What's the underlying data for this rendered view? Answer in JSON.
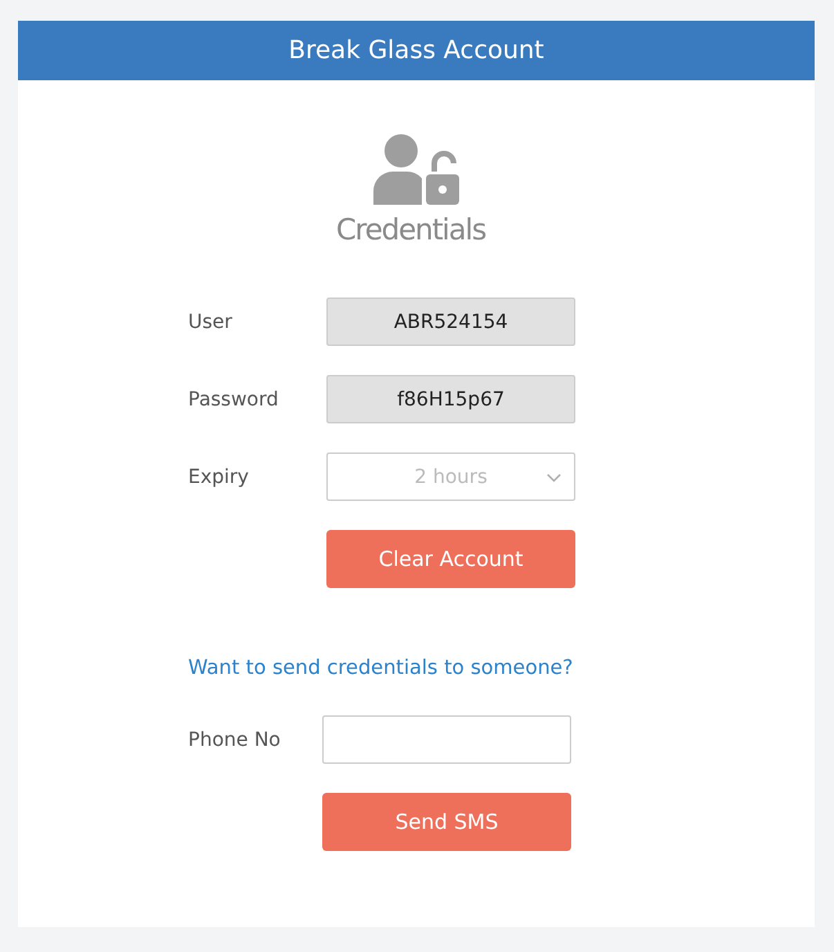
{
  "header": {
    "title": "Break Glass Account"
  },
  "credentials": {
    "heading": "Credentials",
    "fields": [
      {
        "kind": "readonly",
        "label": "User",
        "value": "ABR524154"
      },
      {
        "kind": "readonly",
        "label": "Password",
        "value": "f86H15p67"
      },
      {
        "kind": "select",
        "label": "Expiry",
        "value": "2 hours"
      }
    ],
    "button": "Clear Account"
  },
  "send": {
    "link": "Want to send credentials to someone?",
    "label": "Phone No",
    "button": "Send SMS"
  }
}
